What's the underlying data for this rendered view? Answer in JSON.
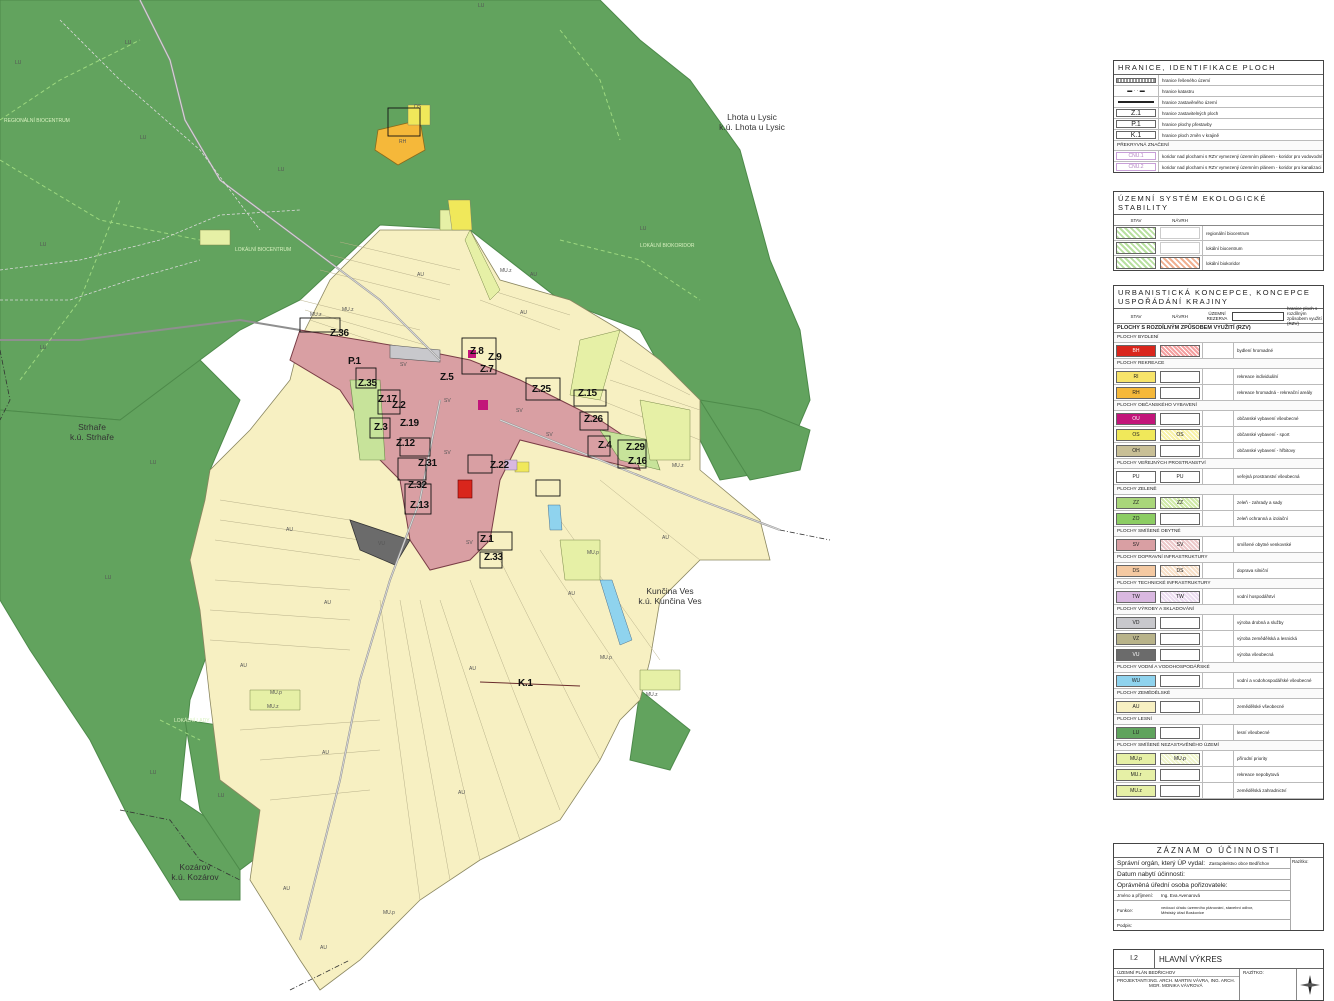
{
  "map": {
    "neighbours": [
      {
        "name": "Lhota u Lysic",
        "cu": "k.ú. Lhota u Lysic"
      },
      {
        "name": "Strhaře",
        "cu": "k.ú. Strhaře"
      },
      {
        "name": "Kunčina Ves",
        "cu": "k.ú. Kunčina Ves"
      },
      {
        "name": "Kozárov",
        "cu": "k.ú. Kozárov"
      }
    ],
    "zone_labels": [
      "LU",
      "LU",
      "LU",
      "LU",
      "LU",
      "LU",
      "LU",
      "LU",
      "LU",
      "LU",
      "LU",
      "LU",
      "AU",
      "AU",
      "AU",
      "AU",
      "AU",
      "AU",
      "AU",
      "AU",
      "AU",
      "AU",
      "AU",
      "AU",
      "AU",
      "SV",
      "SV",
      "SV",
      "SV",
      "SV",
      "SV",
      "VU",
      "RH",
      "OS",
      "MU.z",
      "MU.z",
      "MU.z",
      "MU.p",
      "MU.z",
      "MU.p",
      "MU.z",
      "MU.p",
      "MU.z",
      "MU.p"
    ],
    "z_labels": [
      "Z.1",
      "Z.2",
      "Z.3",
      "Z.4",
      "Z.5",
      "Z.7",
      "Z.8",
      "Z.9",
      "Z.12",
      "Z.13",
      "Z.15",
      "Z.16",
      "Z.17",
      "Z.19",
      "Z.22",
      "Z.25",
      "Z.26",
      "Z.29",
      "Z.31",
      "Z.32",
      "Z.33",
      "Z.35",
      "Z.36",
      "K.1",
      "P.1"
    ],
    "corridor_labels": [
      "LOKÁLNÍ BIOCENTRUM",
      "LOKÁLNÍ BIOKORIDOR",
      "REGIONÁLNÍ BIOCENTRUM",
      "LOKÁLNÍ LADY"
    ]
  },
  "legend_hranice": {
    "title": "HRANICE, IDENTIFIKACE PLOCH",
    "rows": [
      {
        "sym": "",
        "desc": "hranice řešeného území"
      },
      {
        "sym": "",
        "desc": "hranice katastru"
      },
      {
        "sym": "",
        "desc": "hranice zastavěného území"
      },
      {
        "sym": "Z.1",
        "desc": "hranice zastavitelných ploch"
      },
      {
        "sym": "P.1",
        "desc": "hranice plochy přestavby"
      },
      {
        "sym": "K.1",
        "desc": "hranice ploch změn v krajině"
      }
    ],
    "group": "PŘEKRYVNÁ ZNAČENÍ",
    "overlay_rows": [
      {
        "sym": "CNU.1",
        "desc": "koridor nad plochami s RZV vymezený územním plánem - koridor pro vodovodní řad"
      },
      {
        "sym": "CNU.2",
        "desc": "koridor nad plochami s RZV vymezený územním plánem - koridor pro kanalizaci"
      }
    ]
  },
  "legend_uses": {
    "title": "ÚZEMNÍ SYSTÉM EKOLOGICKÉ STABILITY",
    "col_stav": "STAV",
    "col_navrh": "NÁVRH",
    "rows": [
      {
        "desc": "regionální biocentrum"
      },
      {
        "desc": "lokální biocentrum"
      },
      {
        "desc": "lokální biokoridor"
      }
    ]
  },
  "legend_urban": {
    "title": "URBANISTICKÁ KONCEPCE, KONCEPCE USPOŘÁDÁNÍ KRAJINY",
    "col_stav": "STAV",
    "col_navrh": "NÁVRH",
    "col_rezerva": "ÚZEMNÍ REZERVA",
    "col_hranice": "hranice ploch s rozdílným způsobem využití (RZV)",
    "sub": "PLOCHY S ROZDÍLNÝM ZPŮSOBEM VYUŽITÍ (RZV)",
    "groups": [
      {
        "name": "PLOCHY BYDLENÍ",
        "items": [
          {
            "a": "BH",
            "b": "",
            "ca": "#d9261c",
            "cb": "#f4a0a0",
            "desc": "bydlení hromadné"
          }
        ]
      },
      {
        "name": "PLOCHY REKREACE",
        "items": [
          {
            "a": "RI",
            "b": "",
            "ca": "#f7e46a",
            "cb": "",
            "desc": "rekreace individuální"
          },
          {
            "a": "RH",
            "b": "",
            "ca": "#f5b83a",
            "cb": "",
            "desc": "rekreace hromadná - rekreační areály"
          }
        ]
      },
      {
        "name": "PLOCHY OBČANSKÉHO VYBAVENÍ",
        "items": [
          {
            "a": "OU",
            "b": "",
            "ca": "#c2157a",
            "cb": "",
            "desc": "občanské vybavení všeobecné"
          },
          {
            "a": "OS",
            "b": "OS",
            "ca": "#f0e85a",
            "cb": "#f8f2a8",
            "desc": "občanské vybavení - sport"
          },
          {
            "a": "OH",
            "b": "",
            "ca": "#c8bf96",
            "cb": "",
            "desc": "občanské vybavení - hřbitovy"
          }
        ]
      },
      {
        "name": "PLOCHY VEŘEJNÝCH PROSTRANSTVÍ",
        "items": [
          {
            "a": "PU",
            "b": "PU",
            "ca": "#ffffff",
            "cb": "#ffffff",
            "desc": "veřejná prostranství všeobecná"
          }
        ]
      },
      {
        "name": "PLOCHY ZELENĚ",
        "items": [
          {
            "a": "ZZ",
            "b": "ZZ",
            "ca": "#a9d67a",
            "cb": "#d0eaa8",
            "desc": "zeleň - zahrady a sady"
          },
          {
            "a": "ZO",
            "b": "",
            "ca": "#8ccd63",
            "cb": "",
            "desc": "zeleň ochranná a izolační"
          }
        ]
      },
      {
        "name": "PLOCHY SMÍŠENÉ OBYTNÉ",
        "items": [
          {
            "a": "SV",
            "b": "SV",
            "ca": "#d99fa3",
            "cb": "#ecc8ca",
            "desc": "smíšené obytné venkovské"
          }
        ]
      },
      {
        "name": "PLOCHY DOPRAVNÍ INFRASTRUKTURY",
        "items": [
          {
            "a": "DS",
            "b": "DS",
            "ca": "#f4c9a2",
            "cb": "#f8e0c8",
            "desc": "doprava silniční"
          }
        ]
      },
      {
        "name": "PLOCHY TECHNICKÉ INFRASTRUKTURY",
        "items": [
          {
            "a": "TW",
            "b": "TW",
            "ca": "#d9b8e0",
            "cb": "#ecdcf0",
            "desc": "vodní hospodářství"
          }
        ]
      },
      {
        "name": "PLOCHY VÝROBY A SKLADOVÁNÍ",
        "items": [
          {
            "a": "VD",
            "b": "",
            "ca": "#c8c8cc",
            "cb": "",
            "desc": "výroba drobná a služby"
          },
          {
            "a": "VZ",
            "b": "",
            "ca": "#b8b38a",
            "cb": "",
            "desc": "výroba zemědělská a lesnická"
          },
          {
            "a": "VU",
            "b": "",
            "ca": "#6b6b6b",
            "cb": "",
            "desc": "výroba všeobecná"
          }
        ]
      },
      {
        "name": "PLOCHY VODNÍ A VODOHOSPODÁŘSKÉ",
        "items": [
          {
            "a": "WU",
            "b": "",
            "ca": "#8fd3ee",
            "cb": "",
            "desc": "vodní a vodohospodářské všeobecné"
          }
        ]
      },
      {
        "name": "PLOCHY ZEMĚDĚLSKÉ",
        "items": [
          {
            "a": "AU",
            "b": "",
            "ca": "#f7f0c2",
            "cb": "",
            "desc": "zemědělské všeobecné"
          }
        ]
      },
      {
        "name": "PLOCHY LESNÍ",
        "items": [
          {
            "a": "LU",
            "b": "",
            "ca": "#5fa35c",
            "cb": "",
            "desc": "lesní všeobecné"
          }
        ]
      },
      {
        "name": "PLOCHY SMÍŠENÉ NEZASTAVĚNÉHO ÚZEMÍ",
        "items": [
          {
            "a": "MU.p",
            "b": "MU.p",
            "ca": "#e6f0a6",
            "cb": "#f0f6cc",
            "desc": "přírodní priority"
          },
          {
            "a": "MU.r",
            "b": "",
            "ca": "#e6f0a6",
            "cb": "",
            "desc": "rekreace nepobytová"
          },
          {
            "a": "MU.z",
            "b": "",
            "ca": "#e6f0a6",
            "cb": "",
            "desc": "zemědělská zahradnictví"
          }
        ]
      }
    ]
  },
  "zaznam": {
    "title": "ZÁZNAM O ÚČINNOSTI",
    "rows": [
      {
        "k": "Správní orgán, který ÚP vydal:",
        "v": "Zastupitelstvo obce Bedřichov"
      },
      {
        "k": "Datum nabytí účinnosti:",
        "v": ""
      },
      {
        "k": "Oprávněná úřední osoba pořizovatele:",
        "v": ""
      },
      {
        "k": "Jméno a příjmení:",
        "v": "Ing. Eva Avenarová"
      },
      {
        "k": "Funkce:",
        "v": "vedoucí úřadu územního plánování, stavební odbor, Městský úřad Boskovice"
      },
      {
        "k": "Podpis:",
        "v": ""
      }
    ],
    "razitko": "Razítko:"
  },
  "title_block": {
    "number": "I.2",
    "name": "HLAVNÍ VÝKRES",
    "project": "ÚZEMNÍ PLÁN BEDŘICHOV",
    "designers_label": "PROJEKTANTI:",
    "designers": "ING. ARCH. MARTIN VÁVRA, ING. ARCH. MGR. MONIKA VÁVROVÁ",
    "razitko": "RAZÍTKO:"
  },
  "colors": {
    "forest": "#62a35e",
    "agri": "#f7f0c2",
    "mixed": "#d99fa3",
    "greenery": "#c7e39a",
    "recreation": "#f5b83a"
  }
}
